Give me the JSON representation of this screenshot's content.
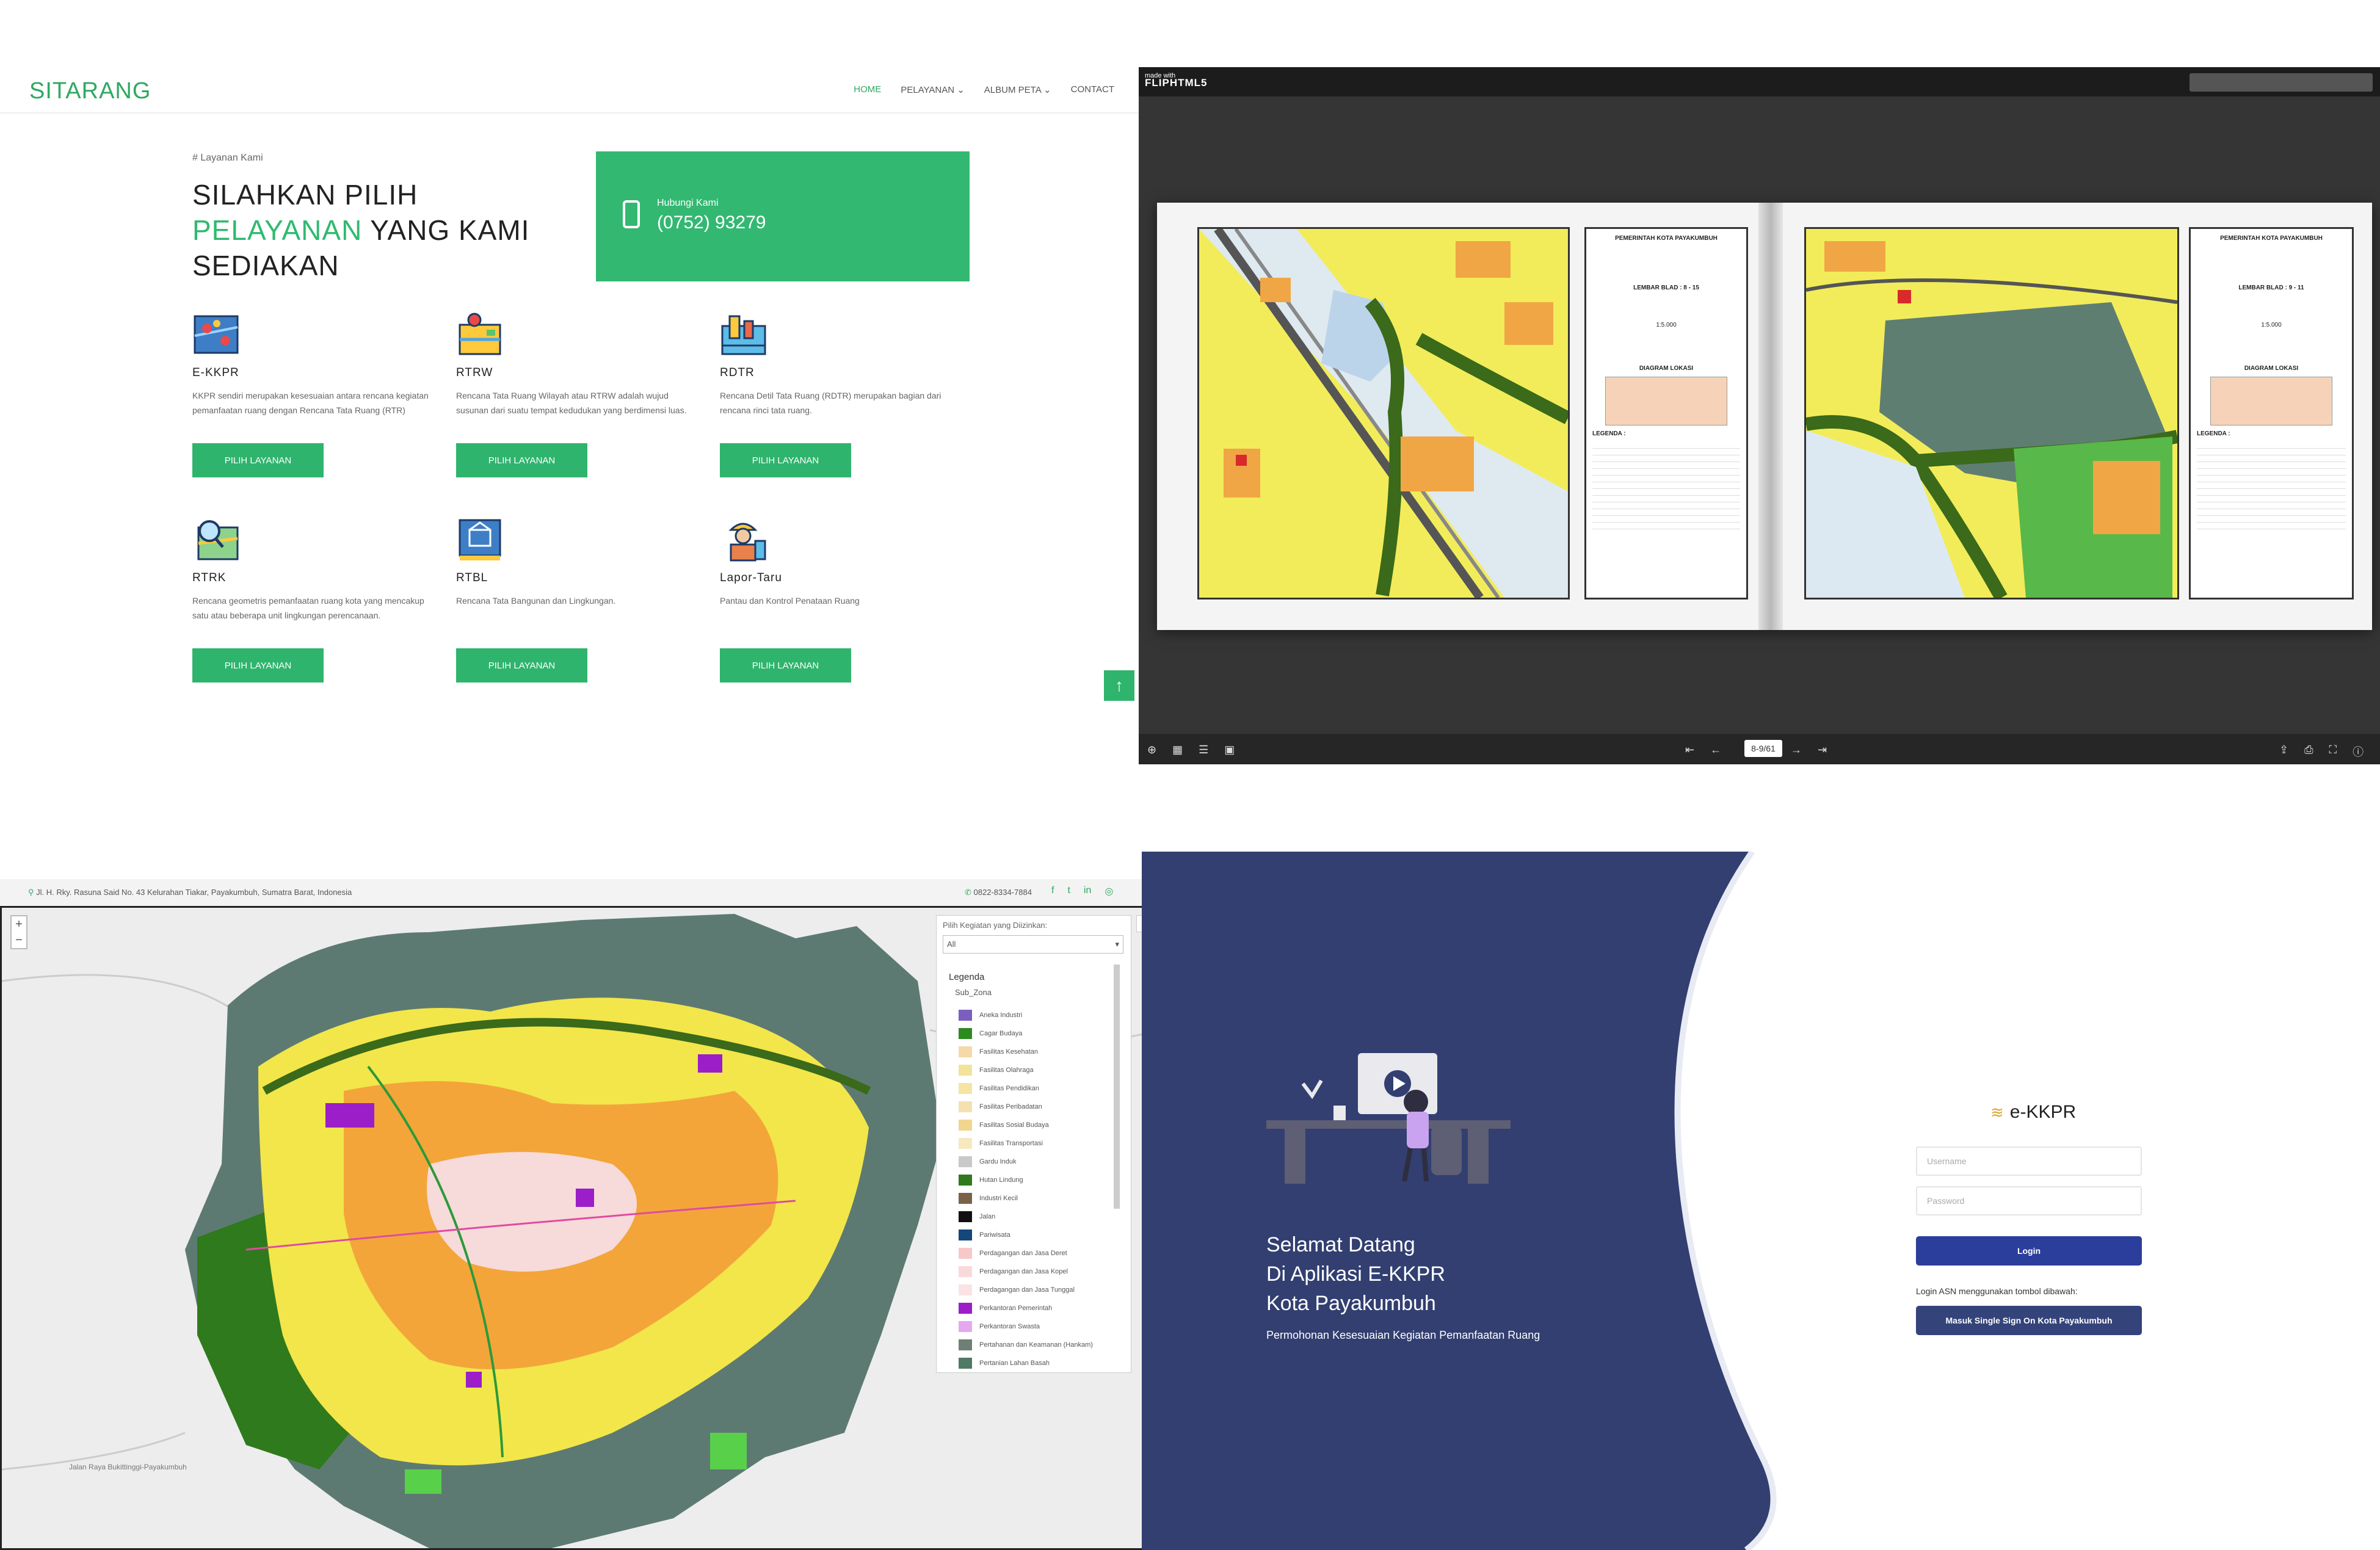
{
  "sitarang": {
    "brand": "SITARANG",
    "menu": [
      "HOME",
      "PELAYANAN ⌄",
      "ALBUM PETA ⌄",
      "CONTACT"
    ],
    "eyebrow": "# Layanan Kami",
    "headline_1": "SILAHKAN PILIH",
    "headline_hl": "PELAYANAN",
    "headline_2": " YANG KAMI",
    "headline_3": "SEDIAKAN",
    "contact_label": "Hubungi Kami",
    "contact_phone": "(0752) 93279",
    "button_label": "PILIH LAYANAN",
    "services": [
      {
        "name": "E-KKPR",
        "desc": "KKPR sendiri merupakan kesesuaian antara rencana kegiatan pemanfaatan ruang dengan Rencana Tata Ruang (RTR)",
        "icon": "map-pins-icon"
      },
      {
        "name": "RTRW",
        "desc": "Rencana Tata Ruang Wilayah atau RTRW adalah wujud susunan dari suatu tempat kedudukan yang berdimensi luas.",
        "icon": "map-scroll-icon"
      },
      {
        "name": "RDTR",
        "desc": "Rencana Detil Tata Ruang (RDTR) merupakan bagian dari rencana rinci tata ruang.",
        "icon": "city-plan-icon"
      },
      {
        "name": "RTRK",
        "desc": "Rencana geometris pemanfaatan ruang kota yang mencakup satu atau beberapa unit lingkungan perencanaan.",
        "icon": "map-search-icon"
      },
      {
        "name": "RTBL",
        "desc": "Rencana Tata Bangunan dan Lingkungan.",
        "icon": "blueprint-icon"
      },
      {
        "name": "Lapor-Taru",
        "desc": "Pantau dan Kontrol Penataan Ruang",
        "icon": "worker-icon"
      }
    ],
    "to_top": "↑"
  },
  "flipbook": {
    "logo_small": "made with",
    "logo_big": "FLIPHTML5",
    "page_indicator": "8-9/61",
    "left_title": "PEMERINTAH KOTA PAYAKUMBUH",
    "right_title": "PEMERINTAH KOTA PAYAKUMBUH",
    "left_sheet": "LEMBAR BLAD : 8 - 15",
    "right_sheet": "LEMBAR BLAD : 9 - 11",
    "scale": "1:5.000",
    "inset_label": "DIAGRAM LOKASI",
    "legend_label": "LEGENDA :"
  },
  "webmap": {
    "address": "Jl. H. Rky. Rasuna Said No. 43 Kelurahan Tiakar, Payakumbuh, Sumatra Barat, Indonesia",
    "phone": "0822-8334-7884",
    "social": [
      "f",
      "t",
      "in",
      "◎"
    ],
    "filter_label": "Pilih Kegiatan yang Diizinkan:",
    "filter_value": "All",
    "legend_title": "Legenda",
    "legend_sub": "Sub_Zona",
    "road_label": "Jalan Raya Bukittinggi-Payakumbuh",
    "legend_items": [
      {
        "label": "Aneka Industri",
        "color": "#7a5fc0"
      },
      {
        "label": "Cagar Budaya",
        "color": "#2e8b1f"
      },
      {
        "label": "Fasilitas Kesehatan",
        "color": "#f6d9a8"
      },
      {
        "label": "Fasilitas Olahraga",
        "color": "#f3e29a"
      },
      {
        "label": "Fasilitas Pendidikan",
        "color": "#f6e4a4"
      },
      {
        "label": "Fasilitas Peribadatan",
        "color": "#f5e0b0"
      },
      {
        "label": "Fasilitas Sosial Budaya",
        "color": "#f2d58e"
      },
      {
        "label": "Fasilitas Transportasi",
        "color": "#f7e8c0"
      },
      {
        "label": "Gardu Induk",
        "color": "#c9c9c9"
      },
      {
        "label": "Hutan Lindung",
        "color": "#2f7a1c"
      },
      {
        "label": "Industri Kecil",
        "color": "#7a6248"
      },
      {
        "label": "Jalan",
        "color": "#111111"
      },
      {
        "label": "Pariwisata",
        "color": "#14477a"
      },
      {
        "label": "Perdagangan dan Jasa Deret",
        "color": "#f7c8c8"
      },
      {
        "label": "Perdagangan dan Jasa Kopel",
        "color": "#f9d9d9"
      },
      {
        "label": "Perdagangan dan Jasa Tunggal",
        "color": "#fbe3e3"
      },
      {
        "label": "Perkantoran Pemerintah",
        "color": "#9b1ec9"
      },
      {
        "label": "Perkantoran Swasta",
        "color": "#e5a8f0"
      },
      {
        "label": "Pertahanan dan Keamanan (Hankam)",
        "color": "#6f7f75"
      },
      {
        "label": "Pertanian Lahan Basah",
        "color": "#4f7a66"
      }
    ]
  },
  "ekkpr": {
    "welcome_1": "Selamat Datang",
    "welcome_2": "Di Aplikasi E-KKPR",
    "welcome_3": "Kota Payakumbuh",
    "welcome_sub": "Permohonan Kesesuaian Kegiatan Pemanfaatan Ruang",
    "app_name": "e-KKPR",
    "username_placeholder": "Username",
    "password_placeholder": "Password",
    "login_label": "Login",
    "asn_note": "Login ASN menggunakan tombol dibawah:",
    "sso_label": "Masuk Single Sign On Kota Payakumbuh"
  }
}
